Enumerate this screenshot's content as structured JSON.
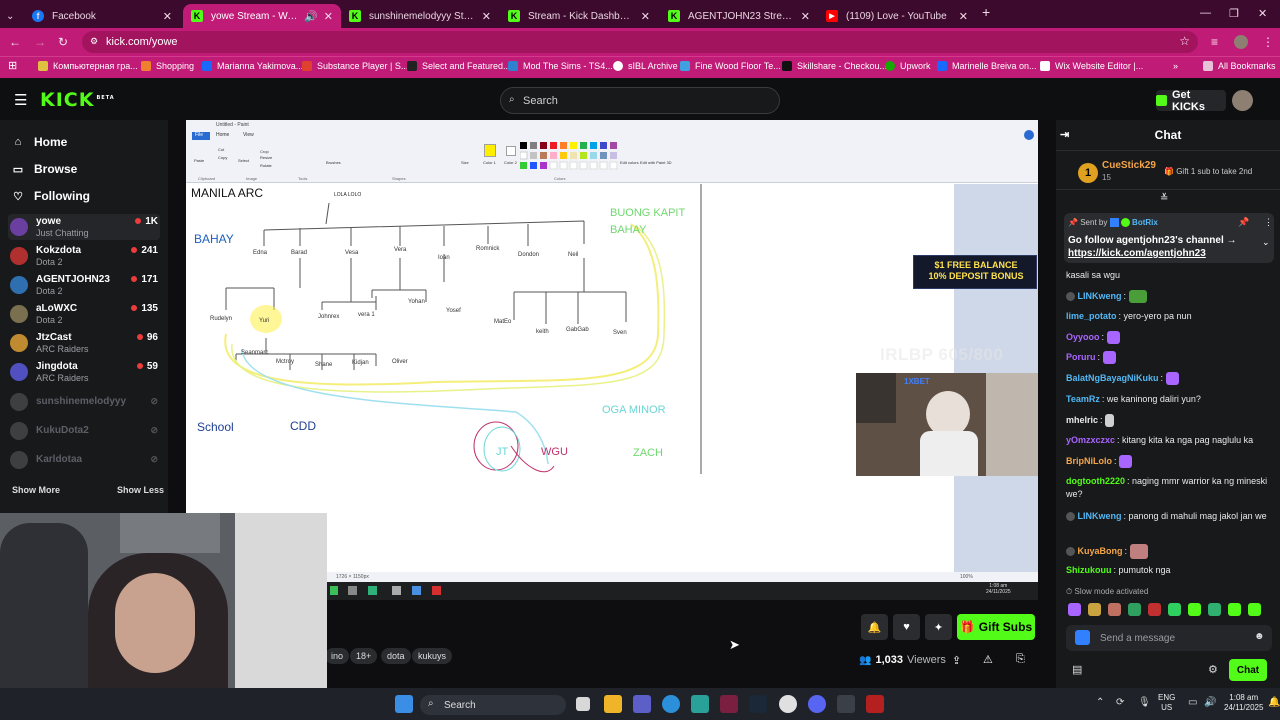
{
  "browser": {
    "tabs": [
      {
        "label": "Facebook",
        "icon": "facebook-icon"
      },
      {
        "label": "yowe Stream - Watch Live o",
        "icon": "kick-icon",
        "active": true
      },
      {
        "label": "sunshinemelodyyy Stream - Wa",
        "icon": "kick-icon"
      },
      {
        "label": "Stream - Kick Dashboard",
        "icon": "kick-icon"
      },
      {
        "label": "AGENTJOHN23 Stream - Watch",
        "icon": "kick-icon"
      },
      {
        "label": "(1109) Love - YouTube",
        "icon": "youtube-icon"
      }
    ],
    "url": "kick.com/yowe",
    "bookmarks": [
      "Компьютерная гра...",
      "Shopping",
      "Marianna Yakimova...",
      "Substance Player | S...",
      "Select and Featured...",
      "Mod The Sims - TS4...",
      "sIBL Archive",
      "Fine Wood Floor Te...",
      "Skillshare - Checkou...",
      "Upwork",
      "Marinelle Breiva on...",
      "Wix Website Editor |..."
    ],
    "all_bookmarks": "All Bookmarks",
    "colors": {
      "tab_strip": "#3c0a2c",
      "accent": "#c01b77"
    }
  },
  "kick": {
    "logo": "KICK",
    "logo_badge": "BETA",
    "search_placeholder": "Search",
    "get_kicks": "Get KICKs",
    "brand_color": "#53fc18"
  },
  "sidebar": {
    "nav": [
      "Home",
      "Browse",
      "Following"
    ],
    "channels": [
      {
        "name": "yowe",
        "category": "Just Chatting",
        "viewers": "1K",
        "live": true,
        "color": "#6b3fa0"
      },
      {
        "name": "Kokzdota",
        "category": "Dota 2",
        "viewers": "241",
        "live": true,
        "color": "#b03030"
      },
      {
        "name": "AGENTJOHN23",
        "category": "Dota 2",
        "viewers": "171",
        "live": true,
        "color": "#2f6fb0"
      },
      {
        "name": "aLoWXC",
        "category": "Dota 2",
        "viewers": "135",
        "live": true,
        "color": "#7a7050"
      },
      {
        "name": "JtzCast",
        "category": "ARC Raiders",
        "viewers": "96",
        "live": true,
        "color": "#c08a30"
      },
      {
        "name": "Jingdota",
        "category": "ARC Raiders",
        "viewers": "59",
        "live": true,
        "color": "#5050c0"
      },
      {
        "name": "sunshinemelodyyy",
        "category": "",
        "viewers": "",
        "live": false,
        "color": "#888"
      },
      {
        "name": "KukuDota2",
        "category": "",
        "viewers": "",
        "live": false,
        "color": "#888"
      },
      {
        "name": "Karldotaa",
        "category": "",
        "viewers": "",
        "live": false,
        "color": "#888"
      }
    ],
    "show_more": "Show More",
    "show_less": "Show Less"
  },
  "stream": {
    "paint_title": "Untitled - Paint",
    "paint_menu": [
      "File",
      "Home",
      "View"
    ],
    "paint_groups": [
      "Clipboard",
      "Image",
      "Tools",
      "Shapes",
      "Colors"
    ],
    "paint_tools": [
      "Paste",
      "Cut",
      "Copy",
      "Select",
      "Crop",
      "Resize",
      "Rotate",
      "Brushes",
      "Size",
      "Color 1",
      "Color 2",
      "Edit colors",
      "Edit with Paint 3D"
    ],
    "canvas_labels": [
      {
        "text": "MANILA ARC",
        "color": "#111"
      },
      {
        "text": "BAHAY",
        "color": "#1f5fbf"
      },
      {
        "text": "LOLA LOLO",
        "color": "#222"
      },
      {
        "text": "BUONG KAPIT",
        "color": "#6fd86f"
      },
      {
        "text": "BAHAY",
        "color": "#6fd86f"
      },
      {
        "text": "Edna",
        "color": "#333"
      },
      {
        "text": "Barad",
        "color": "#333"
      },
      {
        "text": "Vesa",
        "color": "#333"
      },
      {
        "text": "Vera",
        "color": "#333"
      },
      {
        "text": "Ioan",
        "color": "#333"
      },
      {
        "text": "Romnick",
        "color": "#333"
      },
      {
        "text": "Dondon",
        "color": "#333"
      },
      {
        "text": "Neil",
        "color": "#333"
      },
      {
        "text": "Rudelyn",
        "color": "#333"
      },
      {
        "text": "Yuri",
        "color": "#333"
      },
      {
        "text": "Johnrex",
        "color": "#333"
      },
      {
        "text": "vera 1",
        "color": "#333"
      },
      {
        "text": "Yohan",
        "color": "#333"
      },
      {
        "text": "Yosef",
        "color": "#333"
      },
      {
        "text": "MatEo",
        "color": "#333"
      },
      {
        "text": "keith",
        "color": "#333"
      },
      {
        "text": "GabGab",
        "color": "#333"
      },
      {
        "text": "Sven",
        "color": "#333"
      },
      {
        "text": "Seanmarc",
        "color": "#333"
      },
      {
        "text": "Mctroy",
        "color": "#333"
      },
      {
        "text": "Shane",
        "color": "#333"
      },
      {
        "text": "Kidjan",
        "color": "#333"
      },
      {
        "text": "Oliver",
        "color": "#333"
      },
      {
        "text": "School",
        "color": "#1f3f8f"
      },
      {
        "text": "CDD",
        "color": "#1f3f8f"
      },
      {
        "text": "OGA MINOR",
        "color": "#6bd6d6"
      },
      {
        "text": "JT",
        "color": "#6bd6d6"
      },
      {
        "text": "WGU",
        "color": "#c0306a"
      },
      {
        "text": "ZACH",
        "color": "#6fd86f"
      }
    ],
    "canvas_size": "1726 × 1150px",
    "paint_zoom": "100%",
    "stream_time": "1:08 am",
    "stream_date": "24/11/2025",
    "promo": [
      "$1 FREE BALANCE",
      "10% DEPOSIT BONUS"
    ],
    "cam_brand": "1XBET",
    "goal": "IRLBP 605/800"
  },
  "info": {
    "tags": [
      "ino",
      "18+",
      "dota",
      "kukuys"
    ],
    "gift_subs": "Gift Subs",
    "viewers_count": "1,033",
    "viewers_label": "Viewers"
  },
  "chat": {
    "title": "Chat",
    "top_gifter": {
      "name": "CueStick29",
      "count": "15",
      "rank": "1",
      "text": "Gift 1 sub to take 2nd"
    },
    "pinned": {
      "sent_by_label": "Sent by",
      "author": "BotRix",
      "text": "Go follow agentjohn23's channel →",
      "link": "https://kick.com/agentjohn23"
    },
    "messages": [
      {
        "user": "",
        "color": "#e9eaec",
        "text": "kasali sa wgu"
      },
      {
        "user": "LINKweng",
        "color": "#53b8f4",
        "text": "",
        "emote": "#4a9e3a"
      },
      {
        "user": "lime_potato",
        "color": "#53b8f4",
        "text": "yero-yero pa nun"
      },
      {
        "user": "Oyyooo",
        "color": "#a865ff",
        "text": "",
        "emote": "#a865ff"
      },
      {
        "user": "Poruru",
        "color": "#a865ff",
        "text": "",
        "emote": "#a865ff"
      },
      {
        "user": "BalatNgBayagNiKuku",
        "color": "#53b8f4",
        "text": "",
        "emote": "#a865ff"
      },
      {
        "user": "TeamRz",
        "color": "#53b8f4",
        "text": "we kaninong daliri yun?"
      },
      {
        "user": "mhelric",
        "color": "#e9eaec",
        "text": "",
        "emote": "#d0d0d0"
      },
      {
        "user": "yOmzxczxc",
        "color": "#a865ff",
        "text": "kitang kita ka nga pag naglulu ka"
      },
      {
        "user": "BripNiLolo",
        "color": "#f4a64a",
        "text": "",
        "emote": "#a865ff"
      },
      {
        "user": "dogtooth2220",
        "color": "#53fc18",
        "text": "naging mmr warrior ka ng mineski we?"
      },
      {
        "user": "LINKweng",
        "color": "#53b8f4",
        "text": "panong di mahuli mag jakol jan we"
      },
      {
        "user": "KuyaBong",
        "color": "#f4a64a",
        "text": "",
        "emote": "#c08080"
      },
      {
        "user": "Shizukouu",
        "color": "#53fc18",
        "text": "pumutok nga"
      }
    ],
    "slow_mode": "Slow mode activated",
    "emote_bar": [
      "#a865ff",
      "#c9a340",
      "#c07060",
      "#2fa060",
      "#c03030",
      "#2fd060",
      "#53fc18",
      "#2fb070",
      "#53fc18",
      "#53fc18"
    ],
    "input_placeholder": "Send a message",
    "send_label": "Chat"
  },
  "taskbar": {
    "search": "Search",
    "lang": "ENG",
    "region": "US",
    "time": "1:08 am",
    "date": "24/11/2025"
  }
}
